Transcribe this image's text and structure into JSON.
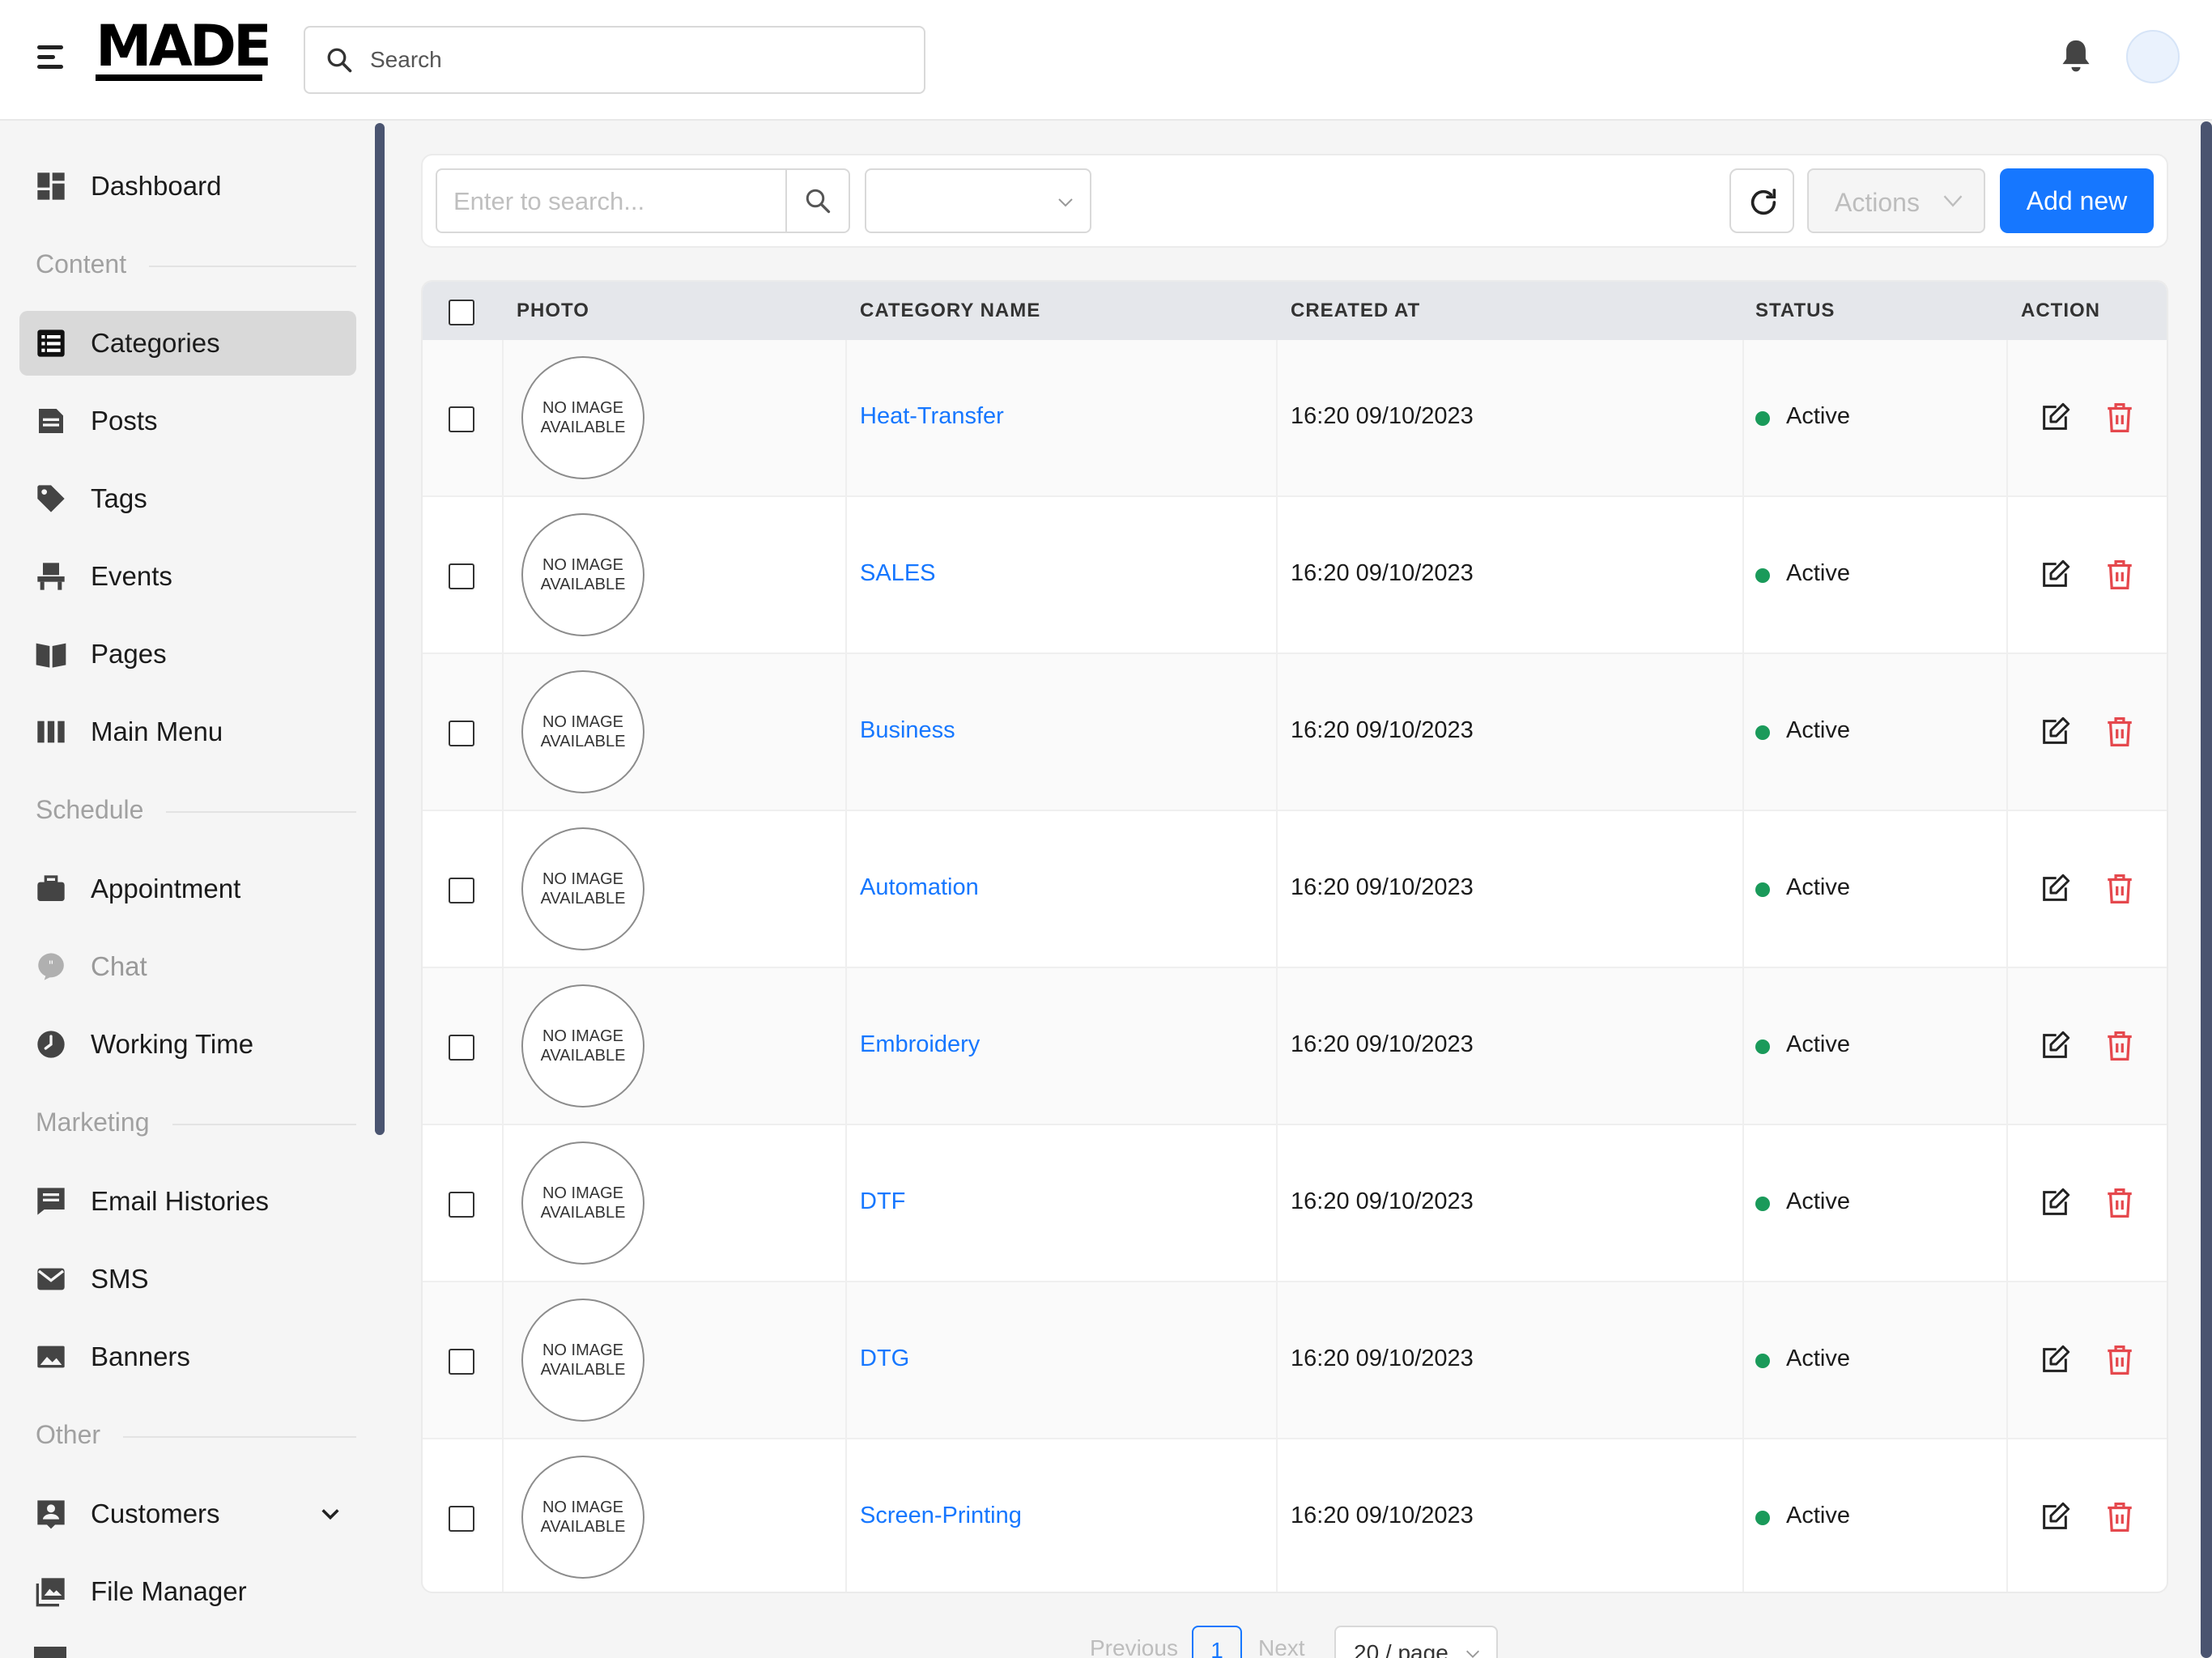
{
  "header": {
    "logo": "MADE",
    "search_placeholder": "Search",
    "icons": [
      "menu-icon",
      "search-icon",
      "bell-icon",
      "avatar"
    ]
  },
  "sidebar": {
    "items": [
      {
        "label": "Dashboard",
        "icon": "dashboard-icon"
      },
      {
        "label": "Categories",
        "icon": "list-icon",
        "active": true
      },
      {
        "label": "Posts",
        "icon": "document-icon"
      },
      {
        "label": "Tags",
        "icon": "tag-icon"
      },
      {
        "label": "Events",
        "icon": "chair-icon"
      },
      {
        "label": "Pages",
        "icon": "book-icon"
      },
      {
        "label": "Main Menu",
        "icon": "columns-icon"
      },
      {
        "label": "Appointment",
        "icon": "briefcase-icon"
      },
      {
        "label": "Chat",
        "icon": "chat-icon"
      },
      {
        "label": "Working Time",
        "icon": "clock-icon"
      },
      {
        "label": "Email Histories",
        "icon": "message-icon"
      },
      {
        "label": "SMS",
        "icon": "mail-icon"
      },
      {
        "label": "Banners",
        "icon": "image-icon"
      },
      {
        "label": "Customers",
        "icon": "contact-icon",
        "expandable": true
      },
      {
        "label": "File Manager",
        "icon": "gallery-icon"
      }
    ],
    "sections": [
      "Content",
      "Schedule",
      "Marketing",
      "Other"
    ]
  },
  "toolbar": {
    "search_placeholder": "Enter to search...",
    "select_value": "",
    "actions_label": "Actions",
    "add_label": "Add new"
  },
  "table": {
    "columns": [
      "PHOTO",
      "CATEGORY NAME",
      "CREATED AT",
      "STATUS",
      "ACTION"
    ],
    "no_image_text_1": "NO IMAGE",
    "no_image_text_2": "AVAILABLE",
    "rows": [
      {
        "name": "Heat-Transfer",
        "created": "16:20 09/10/2023",
        "status": "Active"
      },
      {
        "name": "SALES",
        "created": "16:20 09/10/2023",
        "status": "Active"
      },
      {
        "name": "Business",
        "created": "16:20 09/10/2023",
        "status": "Active"
      },
      {
        "name": "Automation",
        "created": "16:20 09/10/2023",
        "status": "Active"
      },
      {
        "name": "Embroidery",
        "created": "16:20 09/10/2023",
        "status": "Active"
      },
      {
        "name": "DTF",
        "created": "16:20 09/10/2023",
        "status": "Active"
      },
      {
        "name": "DTG",
        "created": "16:20 09/10/2023",
        "status": "Active"
      },
      {
        "name": "Screen-Printing",
        "created": "16:20 09/10/2023",
        "status": "Active"
      }
    ]
  },
  "pagination": {
    "previous": "Previous",
    "current": "1",
    "next": "Next",
    "page_size": "20 / page"
  },
  "colors": {
    "primary": "#1677ff",
    "status_active": "#1a9a5a",
    "delete": "#e5484d",
    "scrollbar": "#4a5470"
  }
}
